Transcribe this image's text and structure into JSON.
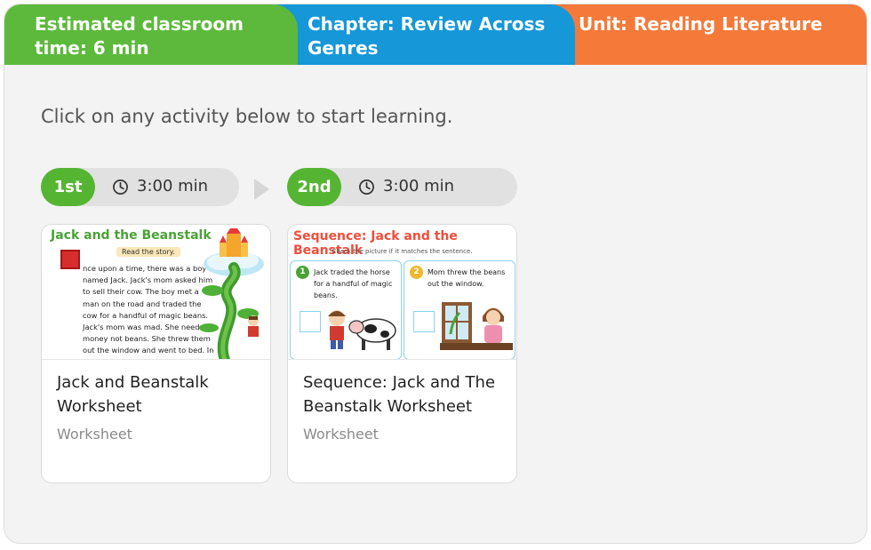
{
  "tabs": {
    "time": "Estimated classroom time: 6 min",
    "chapter": "Chapter: Review Across Genres",
    "unit": "Unit: Reading Literature"
  },
  "intro": "Click on any activity below to start learning.",
  "colors": {
    "green": "#5db93b",
    "blue": "#1597d8",
    "orange": "#f57a3a",
    "panel": "#f3f3f3"
  },
  "activities": [
    {
      "order": "1st",
      "time": "3:00 min",
      "title": "Jack and Beanstalk Worksheet",
      "type": "Worksheet",
      "thumb": {
        "heading": "Jack and the Beanstalk",
        "badge": "Read the story.",
        "story": "nce upon a time, there was a boy named Jack. Jack's mom asked him to sell their cow. The boy met a man on the road and traded the cow for a handful of magic beans.  Jack's mom was mad. She needed money not beans. She threw them out the window and went to bed. In the morning, they"
      }
    },
    {
      "order": "2nd",
      "time": "3:00 min",
      "title": "Sequence: Jack and The Beanstalk Worksheet",
      "type": "Worksheet",
      "thumb": {
        "heading": "Sequence: Jack and the Beanstalk",
        "instruction": "Check the picture if it matches the sentence.",
        "step1_num": "1",
        "step1": "Jack traded the horse for a handful of magic beans.",
        "step2_num": "2",
        "step2": "Mom threw the beans out the window."
      }
    }
  ]
}
